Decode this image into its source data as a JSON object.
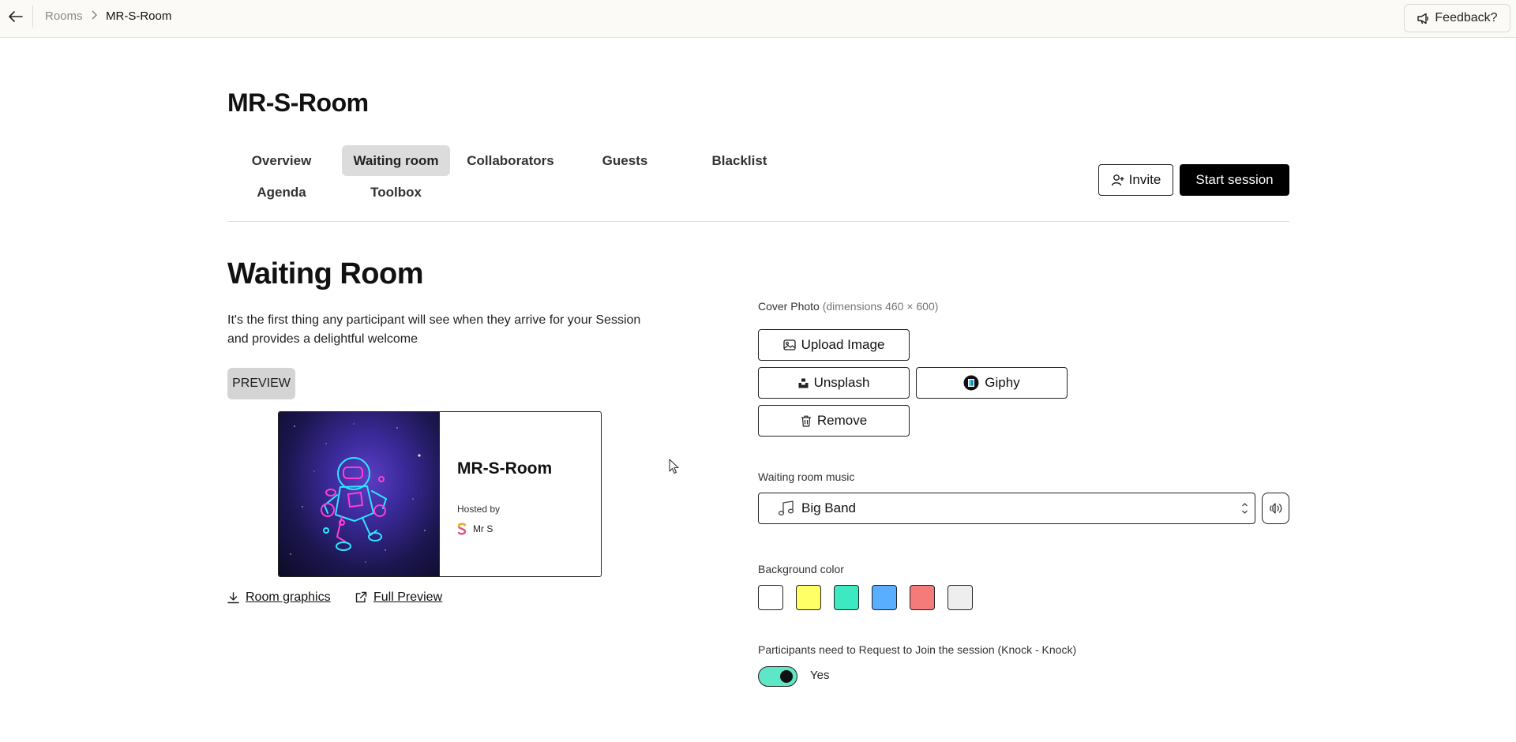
{
  "breadcrumb": {
    "rooms": "Rooms",
    "current": "MR-S-Room"
  },
  "feedback_label": "Feedback?",
  "room": {
    "title": "MR-S-Room"
  },
  "tabs": [
    {
      "label": "Overview",
      "active": false
    },
    {
      "label": "Waiting room",
      "active": true
    },
    {
      "label": "Collaborators",
      "active": false
    },
    {
      "label": "Guests",
      "active": false
    },
    {
      "label": "Blacklist",
      "active": false
    },
    {
      "label": "Agenda",
      "active": false
    },
    {
      "label": "Toolbox",
      "active": false
    }
  ],
  "actions": {
    "invite": "Invite",
    "start_session": "Start session"
  },
  "waiting_room": {
    "title": "Waiting Room",
    "description": "It's the first thing any participant will see when they arrive for your Session and provides a delightful welcome",
    "preview_label": "PREVIEW",
    "card": {
      "room_name": "MR-S-Room",
      "hosted_by": "Hosted by",
      "host_name": "Mr S"
    },
    "links": {
      "room_graphics": "Room graphics",
      "full_preview": "Full Preview"
    }
  },
  "cover_photo": {
    "label": "Cover Photo",
    "hint": "(dimensions 460 × 600)",
    "upload": "Upload Image",
    "unsplash": "Unsplash",
    "giphy": "Giphy",
    "remove": "Remove"
  },
  "music": {
    "label": "Waiting room music",
    "selected": "Big Band"
  },
  "background": {
    "label": "Background color",
    "swatches": [
      "#ffffff",
      "#ffff66",
      "#3ee8c0",
      "#5aaeff",
      "#f57a7a",
      "#eeeeee"
    ]
  },
  "knock": {
    "label": "Participants need to Request to Join the session (Knock - Knock)",
    "value_label": "Yes",
    "enabled": true
  }
}
